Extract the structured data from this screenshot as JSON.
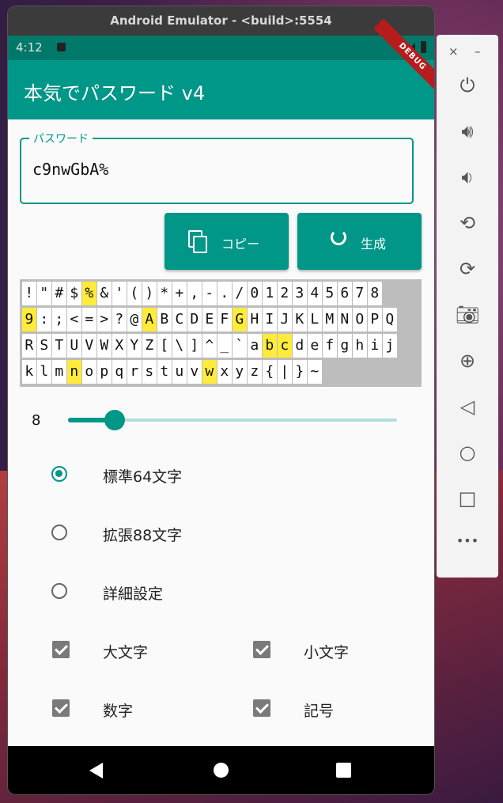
{
  "window": {
    "title": "Android Emulator - <build>:5554"
  },
  "status": {
    "time": "4:12"
  },
  "debug_banner": "DEBUG",
  "app": {
    "title": "本気でパスワード v4"
  },
  "password": {
    "label": "パスワード",
    "value": "c9nwGbA%"
  },
  "buttons": {
    "copy": "コピー",
    "generate": "生成"
  },
  "char_grid": {
    "rows": [
      [
        "!",
        "\"",
        "#",
        "$",
        "%",
        "&",
        "'",
        "(",
        ")",
        "*",
        "+",
        ",",
        "-",
        ".",
        "/",
        "0",
        "1",
        "2",
        "3",
        "4",
        "5",
        "6",
        "7",
        "8"
      ],
      [
        "9",
        ":",
        ";",
        "<",
        "=",
        ">",
        "?",
        "@",
        "A",
        "B",
        "C",
        "D",
        "E",
        "F",
        "G",
        "H",
        "I",
        "J",
        "K",
        "L",
        "M",
        "N",
        "O",
        "P",
        "Q"
      ],
      [
        "R",
        "S",
        "T",
        "U",
        "V",
        "W",
        "X",
        "Y",
        "Z",
        "[",
        "\\",
        "]",
        "^",
        "_",
        "`",
        "a",
        "b",
        "c",
        "d",
        "e",
        "f",
        "g",
        "h",
        "i",
        "j"
      ],
      [
        "k",
        "l",
        "m",
        "n",
        "o",
        "p",
        "q",
        "r",
        "s",
        "t",
        "u",
        "v",
        "w",
        "x",
        "y",
        "z",
        "{",
        "|",
        "}",
        "~"
      ]
    ],
    "highlighted": [
      "%",
      "9",
      "A",
      "G",
      "b",
      "c",
      "n",
      "w"
    ]
  },
  "slider": {
    "value": "8"
  },
  "charset_options": [
    {
      "label": "標準64文字",
      "selected": true
    },
    {
      "label": "拡張88文字",
      "selected": false
    },
    {
      "label": "詳細設定",
      "selected": false
    }
  ],
  "checkboxes": {
    "uppercase": "大文字",
    "lowercase": "小文字",
    "digits": "数字",
    "symbols": "記号"
  },
  "side_toolbar": {
    "close": "×",
    "minimize": "–",
    "more": "•••"
  },
  "colors": {
    "primary": "#009688",
    "primary_dark": "#00796b",
    "highlight": "#ffeb3b"
  }
}
